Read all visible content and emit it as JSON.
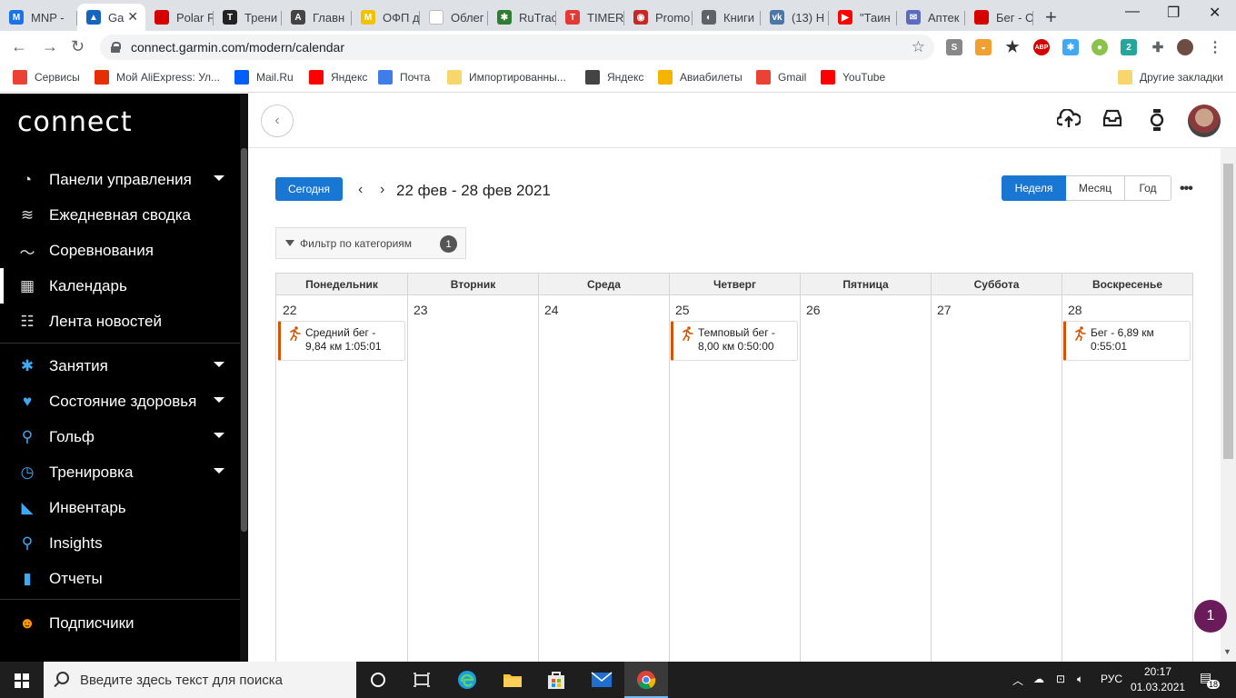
{
  "browser": {
    "tabs": [
      {
        "label": "MNP -",
        "fav_color": "#1a73e8",
        "fav_text": "M"
      },
      {
        "label": "Ga",
        "fav_color": "#1565c0",
        "fav_text": "▲",
        "active": true
      },
      {
        "label": "Polar F",
        "fav_color": "#d50000",
        "fav_text": ""
      },
      {
        "label": "Трени",
        "fav_color": "#222222",
        "fav_text": "T"
      },
      {
        "label": "Главн",
        "fav_color": "#444444",
        "fav_text": "A"
      },
      {
        "label": "ОФП д",
        "fav_color": "#f2c200",
        "fav_text": "M"
      },
      {
        "label": "Облег",
        "fav_color": "#ffffff",
        "fav_text": ""
      },
      {
        "label": "RuTrac",
        "fav_color": "#2e7d32",
        "fav_text": "✱"
      },
      {
        "label": "TIMER",
        "fav_color": "#e53935",
        "fav_text": "T"
      },
      {
        "label": "Promo",
        "fav_color": "#c62828",
        "fav_text": "◉"
      },
      {
        "label": "Книги",
        "fav_color": "#5f6368",
        "fav_text": "◐"
      },
      {
        "label": "(13) Н",
        "fav_color": "#4a76a8",
        "fav_text": "vk"
      },
      {
        "label": "\"Таин",
        "fav_color": "#ff0000",
        "fav_text": "▶"
      },
      {
        "label": "Аптек",
        "fav_color": "#5c6bc0",
        "fav_text": "✉"
      },
      {
        "label": "Бег - С",
        "fav_color": "#d50000",
        "fav_text": ""
      }
    ],
    "url": "connect.garmin.com/modern/calendar",
    "bookmarks": [
      {
        "label": "Сервисы",
        "color": "#ea4335",
        "icon": "apps-icon"
      },
      {
        "label": "Мой AliExpress: Ул...",
        "color": "#e62e04",
        "icon": "aliexpress-icon"
      },
      {
        "label": "Mail.Ru",
        "color": "#005ff9",
        "icon": "mailru-icon"
      },
      {
        "label": "Яндекс",
        "color": "#ff0000",
        "icon": "yandex-icon"
      },
      {
        "label": "Почта",
        "color": "#3f7ee8",
        "icon": "mail-icon"
      },
      {
        "label": "Импортированны...",
        "color": "#f9d56e",
        "icon": "folder-icon"
      },
      {
        "label": "Яндекс",
        "color": "#444444",
        "icon": "globe-icon"
      },
      {
        "label": "Авиабилеты",
        "color": "#f4b400",
        "icon": "plane-icon"
      },
      {
        "label": "Gmail",
        "color": "#ea4335",
        "icon": "gmail-icon"
      },
      {
        "label": "YouTube",
        "color": "#ff0000",
        "icon": "youtube-icon"
      }
    ],
    "other_bookmarks": "Другие закладки",
    "ext_badge": "2"
  },
  "sidebar": {
    "logo": "connect",
    "items": [
      {
        "label": "Панели управления",
        "icon": "gauge-icon",
        "has_chevron": true
      },
      {
        "label": "Ежедневная сводка",
        "icon": "layers-icon",
        "has_chevron": false
      },
      {
        "label": "Соревнования",
        "icon": "trend-icon",
        "has_chevron": false
      },
      {
        "label": "Календарь",
        "icon": "calendar-icon",
        "has_chevron": false,
        "active": true
      },
      {
        "label": "Лента новостей",
        "icon": "newsfeed-icon",
        "has_chevron": false
      },
      {
        "label": "Занятия",
        "icon": "activity-icon",
        "has_chevron": true
      },
      {
        "label": "Состояние здоровья",
        "icon": "heart-icon",
        "has_chevron": true
      },
      {
        "label": "Гольф",
        "icon": "golf-icon",
        "has_chevron": true
      },
      {
        "label": "Тренировка",
        "icon": "stopwatch-icon",
        "has_chevron": true
      },
      {
        "label": "Инвентарь",
        "icon": "shoe-icon",
        "has_chevron": false
      },
      {
        "label": "Insights",
        "icon": "lightbulb-icon",
        "has_chevron": false
      },
      {
        "label": "Отчеты",
        "icon": "bar-chart-icon",
        "has_chevron": false
      },
      {
        "label": "Подписчики",
        "icon": "people-icon",
        "has_chevron": false
      }
    ]
  },
  "toolbar": {
    "today": "Сегодня",
    "date_range": "22 фев - 28 фев 2021",
    "views": [
      "Неделя",
      "Месяц",
      "Год"
    ],
    "active_view": "Неделя",
    "more": "•••"
  },
  "filter": {
    "label": "Фильтр по категориям",
    "count": "1"
  },
  "calendar": {
    "days": [
      {
        "name": "Понедельник",
        "num": "22",
        "events": [
          {
            "line1": "Средний бег -",
            "line2": "9,84 км 1:05:01"
          }
        ]
      },
      {
        "name": "Вторник",
        "num": "23",
        "events": []
      },
      {
        "name": "Среда",
        "num": "24",
        "events": []
      },
      {
        "name": "Четверг",
        "num": "25",
        "events": [
          {
            "line1": "Темповый бег -",
            "line2": "8,00 км 0:50:00"
          }
        ]
      },
      {
        "name": "Пятница",
        "num": "26",
        "events": []
      },
      {
        "name": "Суббота",
        "num": "27",
        "events": []
      },
      {
        "name": "Воскресенье",
        "num": "28",
        "events": [
          {
            "line1": "Бег - 6,89 км",
            "line2": "0:55:01"
          }
        ]
      }
    ],
    "event_accent": "#d35400"
  },
  "notification_count": "1",
  "taskbar": {
    "search_placeholder": "Введите здесь текст для поиска",
    "lang": "РУС",
    "time": "20:17",
    "date": "01.03.2021",
    "notif_badge": "18"
  }
}
